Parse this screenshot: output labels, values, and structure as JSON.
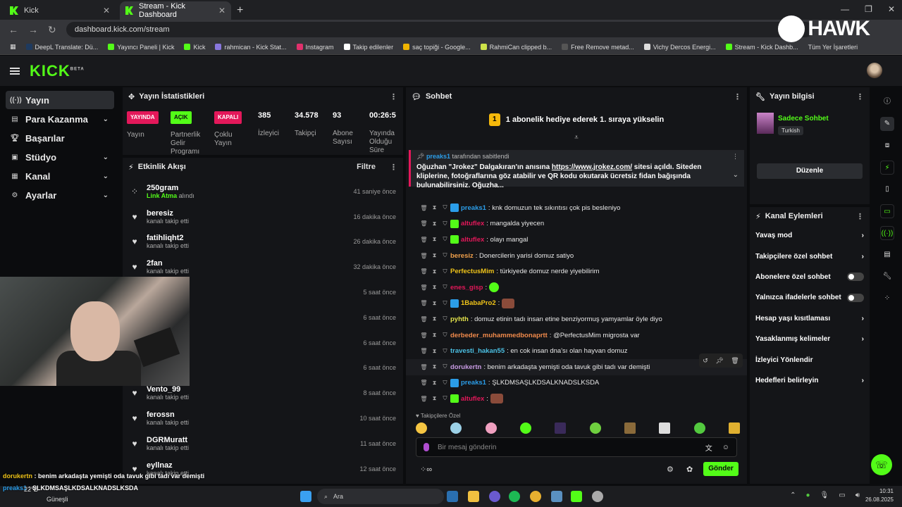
{
  "browser": {
    "tabs": [
      {
        "label": "Kick",
        "active": false
      },
      {
        "label": "Stream - Kick Dashboard",
        "active": true
      }
    ],
    "url": "dashboard.kick.com/stream",
    "bookmarks": [
      {
        "label": "DeepL Translate: Dü...",
        "color": "#1e3a5f"
      },
      {
        "label": "Yayıncı Paneli | Kick",
        "color": "#53fc18"
      },
      {
        "label": "Kick",
        "color": "#53fc18"
      },
      {
        "label": "rahmican - Kick Stat...",
        "color": "#8877dd"
      },
      {
        "label": "Instagram",
        "color": "#e1306c"
      },
      {
        "label": "Takip edilenler",
        "color": "#ffffff"
      },
      {
        "label": "saç topiği - Google...",
        "color": "#f0b400"
      },
      {
        "label": "RahmiCan clipped b...",
        "color": "#cde349"
      },
      {
        "label": "Free Remove metad...",
        "color": "#555555"
      },
      {
        "label": "Vichy Dercos Energi...",
        "color": "#dddddd"
      },
      {
        "label": "Stream - Kick Dashb...",
        "color": "#53fc18"
      }
    ],
    "all_bookmarks": "Tüm Yer İşaretleri"
  },
  "logo": {
    "hawk": "HAWK",
    "kick": "KICK",
    "beta": "BETA"
  },
  "nav": [
    {
      "label": "Yayın",
      "icon": "broadcast-icon",
      "active": true,
      "chevron": false
    },
    {
      "label": "Para Kazanma",
      "icon": "money-icon",
      "active": false,
      "chevron": true
    },
    {
      "label": "Başarılar",
      "icon": "trophy-icon",
      "active": false,
      "chevron": false
    },
    {
      "label": "Stüdyo",
      "icon": "studio-icon",
      "active": false,
      "chevron": true
    },
    {
      "label": "Kanal",
      "icon": "channel-icon",
      "active": false,
      "chevron": true
    },
    {
      "label": "Ayarlar",
      "icon": "gear-icon",
      "active": false,
      "chevron": true
    }
  ],
  "stats": {
    "title": "Yayın İstatistikleri",
    "items": [
      {
        "badge": "YAYINDA",
        "badge_color": "red",
        "label": "Yayın"
      },
      {
        "badge": "AÇIK",
        "badge_color": "green",
        "label": "Partnerlik Gelir Programı"
      },
      {
        "badge": "KAPALI",
        "badge_color": "red",
        "label": "Çoklu Yayın"
      },
      {
        "value": "385",
        "label": "İzleyici"
      },
      {
        "value": "34.578",
        "label": "Takipçi"
      },
      {
        "value": "93",
        "label": "Abone Sayısı"
      },
      {
        "value": "00:26:5",
        "label": "Yayında Olduğu Süre"
      }
    ]
  },
  "activity": {
    "title": "Etkinlik Akışı",
    "filter": "Filtre",
    "items": [
      {
        "name": "250gram",
        "action": "Link Atma",
        "action_suffix": "alındı",
        "time": "41 saniye önce",
        "icon": "share-icon"
      },
      {
        "name": "beresiz",
        "action": "",
        "action_suffix": "kanalı takip etti",
        "time": "16 dakika önce",
        "icon": "heart-icon"
      },
      {
        "name": "fatihliqht2",
        "action": "",
        "action_suffix": "kanalı takip etti",
        "time": "26 dakika önce",
        "icon": "heart-icon"
      },
      {
        "name": "2fan",
        "action": "",
        "action_suffix": "kanalı takip etti",
        "time": "32 dakika önce",
        "icon": "heart-icon"
      },
      {
        "name": "",
        "action": "",
        "action_suffix": "",
        "time": "5 saat önce",
        "icon": "heart-icon"
      },
      {
        "name": "",
        "action": "",
        "action_suffix": "",
        "time": "6 saat önce",
        "icon": "heart-icon"
      },
      {
        "name": "",
        "action": "",
        "action_suffix": "",
        "time": "6 saat önce",
        "icon": "heart-icon"
      },
      {
        "name": "",
        "action": "",
        "action_suffix": "",
        "time": "6 saat önce",
        "icon": "heart-icon"
      },
      {
        "name": "Vento_99",
        "action": "",
        "action_suffix": "kanalı takip etti",
        "time": "8 saat önce",
        "icon": "heart-icon"
      },
      {
        "name": "ferossn",
        "action": "",
        "action_suffix": "kanalı takip etti",
        "time": "10 saat önce",
        "icon": "heart-icon"
      },
      {
        "name": "DGRMuratt",
        "action": "",
        "action_suffix": "kanalı takip etti",
        "time": "11 saat önce",
        "icon": "heart-icon"
      },
      {
        "name": "eyllnaz",
        "action": "",
        "action_suffix": "kanalı takip etti",
        "time": "12 saat önce",
        "icon": "heart-icon"
      }
    ]
  },
  "chat": {
    "title": "Sohbet",
    "gift_text": "1 abonelik hediye ederek 1. sıraya yükselin",
    "gift_rank": "1",
    "pinned": {
      "by_user": "preaks1",
      "by_text": "tarafından sabitlendi",
      "msg_before": "Oğuzhan \"Jrokez\" Dalgakıran'ın anısına ",
      "link": "https://www.jrokez.com/",
      "msg_after": " sitesi açıldı. Siteden kliplerine, fotoğraflarına göz atabilir ve QR kodu okutarak ücretsiz fidan bağışında bulunabilirsiniz. Oğuzha..."
    },
    "messages": [
      {
        "user": "preaks1",
        "color": "#2b9de8",
        "text": "knk domuzun tek sıkıntısı çok pis besleniyo",
        "badges": [
          "#2b9de8"
        ]
      },
      {
        "user": "altuflex",
        "color": "#e3185a",
        "text": "mangalda yiyecen",
        "badges": [
          "#53fc18"
        ]
      },
      {
        "user": "altuflex",
        "color": "#e3185a",
        "text": "olayı mangal",
        "badges": [
          "#53fc18"
        ]
      },
      {
        "user": "beresiz",
        "color": "#f0a04b",
        "text": "Donercilerin yarisi domuz satiyo",
        "badges": []
      },
      {
        "user": "PerfectusMim",
        "color": "#f0c419",
        "text": "türkiyede domuz nerde yiyebilirim",
        "badges": []
      },
      {
        "user": "enes_gisp",
        "color": "#e3185a",
        "text": "",
        "badges": [],
        "emote": "#53fc18"
      },
      {
        "user": "1BabaPro2",
        "color": "#f0c419",
        "text": "",
        "badges": [
          "#2b9de8"
        ],
        "emote": "#8a4b3a"
      },
      {
        "user": "pyhth",
        "color": "#e3e34b",
        "text": "domuz etinin tadı insan etine benziyormuş yamyamlar öyle diyo",
        "badges": []
      },
      {
        "user": "derbeder_muhammedbonaprtt",
        "color": "#f08a4b",
        "text": "@PerfectusMim migrosta var",
        "badges": []
      },
      {
        "user": "travesti_hakan55",
        "color": "#4bc0e3",
        "text": "en cok insan dna'sı olan hayvan domuz",
        "badges": []
      },
      {
        "user": "dorukertn",
        "color": "#c89be3",
        "text": "benim arkadaşta yemişti oda tavuk gibi tadı var demişti",
        "badges": []
      },
      {
        "user": "preaks1",
        "color": "#2b9de8",
        "text": "ŞLKDMSAŞLKDSALKNADSLKSDA",
        "badges": [
          "#2b9de8"
        ]
      },
      {
        "user": "altuflex",
        "color": "#e3185a",
        "text": "",
        "badges": [
          "#53fc18"
        ],
        "emote": "#8a4b3a"
      }
    ],
    "followers_only": "Takipçilere Özel",
    "emojis": [
      "#f5c542",
      "#9bd0e6",
      "#f0a0c0",
      "#53fc18",
      "#3a2a5a",
      "#6fcf3f",
      "#8a6a3a",
      "#dddddd",
      "#53c93f",
      "#e0b030"
    ],
    "placeholder": "Bir mesaj gönderin",
    "send": "Gönder"
  },
  "info": {
    "title": "Yayın bilgisi",
    "category": "Sadece Sohbet",
    "language": "Turkish",
    "edit": "Düzenle"
  },
  "actions": {
    "title": "Kanal Eylemleri",
    "items": [
      {
        "label": "Yavaş mod",
        "type": "chevron"
      },
      {
        "label": "Takipçilere özel sohbet",
        "type": "chevron"
      },
      {
        "label": "Abonelere özel sohbet",
        "type": "toggle"
      },
      {
        "label": "Yalnızca ifadelerle sohbet",
        "type": "toggle"
      },
      {
        "label": "Hesap yaşı kısıtlaması",
        "type": "chevron"
      },
      {
        "label": "Yasaklanmış kelimeler",
        "type": "chevron"
      },
      {
        "label": "İzleyici Yönlendir",
        "type": "none"
      },
      {
        "label": "Hedefleri belirleyin",
        "type": "chevron"
      }
    ]
  },
  "overlay": {
    "line1_user": "dorukertn",
    "line1_text": "benim arkadaşta yemişti oda tavuk gibi tadı var demişti",
    "line2_user": "preaks1",
    "line2_text": "ŞLKDMSAŞLKDSALKNADSLKSDA",
    "line3": "Güneşli"
  },
  "taskbar": {
    "search": "Ara",
    "weather": "22°C",
    "time": "10:31",
    "date": "26.08.2025"
  }
}
